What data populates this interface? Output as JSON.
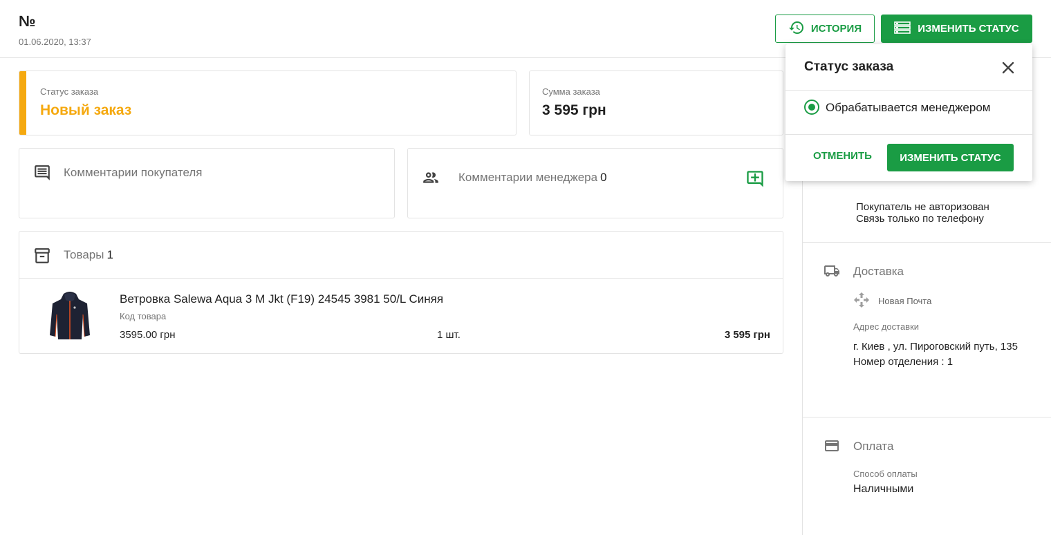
{
  "header": {
    "order_number_label": "№",
    "order_date": "01.06.2020, 13:37",
    "history_button": "История",
    "change_status_button": "Изменить статус"
  },
  "status_card": {
    "label": "Статус заказа",
    "value": "Новый заказ",
    "accent_color": "#f5a910"
  },
  "sum_card": {
    "label": "Сумма заказа",
    "value": "3 595 грн"
  },
  "buyer_comments": {
    "title": "Комментарии покупателя"
  },
  "manager_comments": {
    "title": "Комментарии менеджера",
    "count": "0"
  },
  "goods": {
    "title": "Товары",
    "count": "1",
    "items": [
      {
        "name": "Ветровка Salewa Aqua 3 M Jkt (F19) 24545 3981 50/L Синяя",
        "code_label": "Код товара",
        "price": "3595.00 грн",
        "qty": "1 шт.",
        "total": "3 595 грн"
      }
    ]
  },
  "sidebar": {
    "buyer_note_line1": "Покупатель не авторизован",
    "buyer_note_line2": "Связь только по телефону",
    "delivery": {
      "title": "Доставка",
      "carrier": "Новая Почта",
      "address_label": "Адрес доставки",
      "address_line1": "г. Киев , ул. Пироговский путь, 135",
      "address_line2": "Номер отделения : 1"
    },
    "payment": {
      "title": "Оплата",
      "method_label": "Способ оплаты",
      "method_value": "Наличными"
    }
  },
  "status_popup": {
    "title": "Статус заказа",
    "option": "Обрабатывается менеджером",
    "cancel": "Отменить",
    "confirm": "Изменить статус"
  },
  "colors": {
    "brand_green": "#1a9c44",
    "status_orange": "#f5a910"
  }
}
